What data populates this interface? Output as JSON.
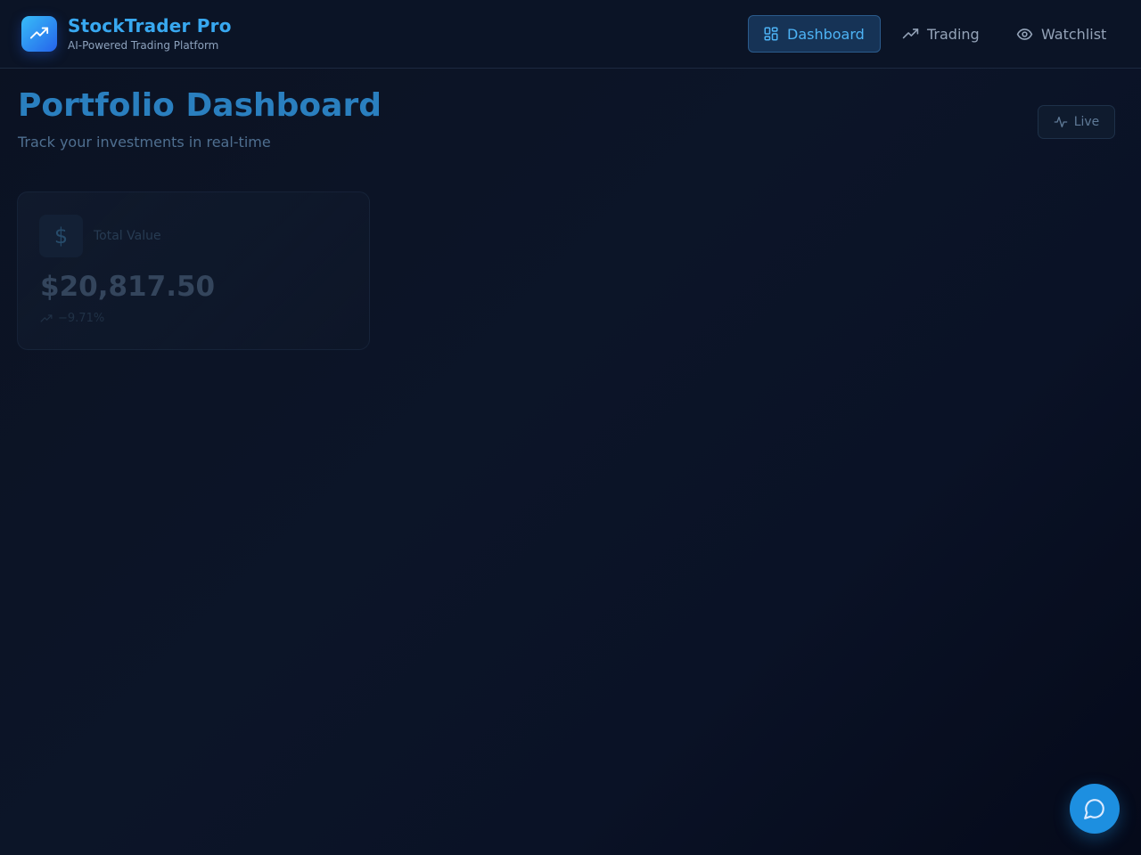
{
  "brand": {
    "title": "StockTrader Pro",
    "subtitle": "AI-Powered Trading Platform",
    "logo_icon": "trending-up-icon"
  },
  "nav": {
    "items": [
      {
        "label": "Dashboard",
        "icon": "dashboard-grid-icon",
        "active": true
      },
      {
        "label": "Trading",
        "icon": "trending-up-icon",
        "active": false
      },
      {
        "label": "Watchlist",
        "icon": "eye-icon",
        "active": false
      }
    ]
  },
  "header": {
    "title": "Portfolio Dashboard",
    "subtitle": "Track your investments in real-time",
    "live_label": "Live",
    "live_icon": "activity-pulse-icon"
  },
  "stats": {
    "total_value": {
      "icon": "dollar-icon",
      "label": "Total Value",
      "value": "$20,817.50",
      "change": "−9.71%",
      "change_icon": "trending-up-icon"
    }
  },
  "chat": {
    "icon": "chat-bubble-icon"
  },
  "colors": {
    "accent": "#38a8f0",
    "nav_active_bg": "#163356",
    "fab": "#1d8fe0",
    "background": "#0b1222"
  }
}
